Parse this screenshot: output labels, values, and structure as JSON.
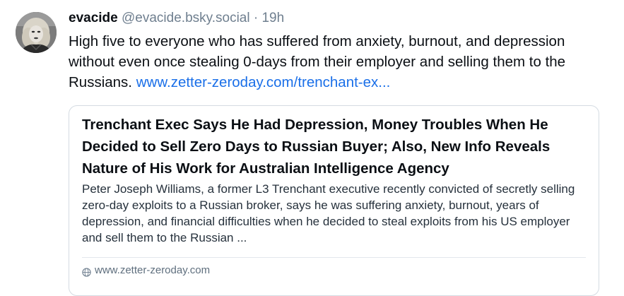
{
  "post": {
    "author": {
      "display_name": "evacide",
      "handle": "@evacide.bsky.social",
      "separator": "·",
      "timestamp": "19h",
      "avatar_icon": "user-avatar-photo"
    },
    "text": "High five to everyone who has suffered from anxiety, burnout, and depression without even once stealing 0-days from their employer and selling them to the Russians. ",
    "link_text": "www.zetter-zeroday.com/trenchant-ex...",
    "link_color": "#1a6fe8"
  },
  "card": {
    "title": "Trenchant Exec Says He Had Depression, Money Troubles When He Decided to Sell Zero Days to Russian Buyer; Also, New Info Reveals Nature of His Work for Australian Intelligence Agency",
    "description": "Peter Joseph Williams, a former L3 Trenchant executive recently convicted of secretly selling zero-day exploits to a Russian broker, says he was suffering anxiety, burnout, years of depression, and financial difficulties when he decided to steal exploits from his US employer and sell them to the Russian ...",
    "domain": "www.zetter-zeroday.com",
    "domain_icon": "globe-icon"
  }
}
